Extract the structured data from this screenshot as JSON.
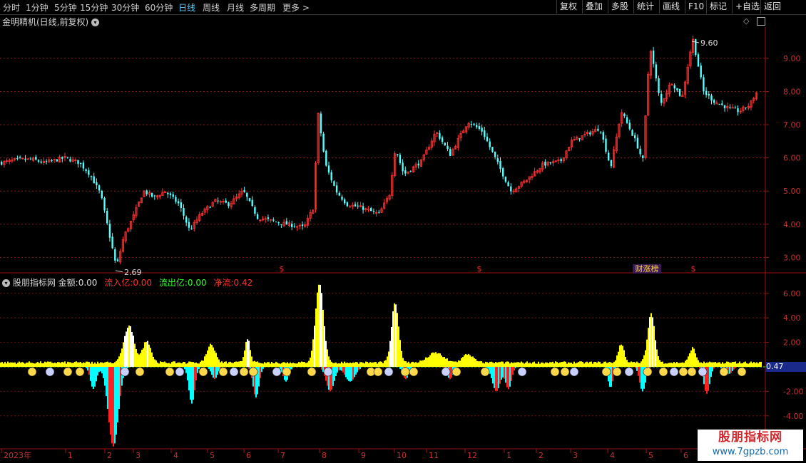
{
  "toolbar": {
    "timeframes": [
      "分时",
      "1分钟",
      "5分钟",
      "15分钟",
      "30分钟",
      "60分钟",
      "日线",
      "周线",
      "月线",
      "多周期",
      "更多 >"
    ],
    "active_timeframe": "日线",
    "actions": [
      "复权",
      "叠加",
      "多股",
      "统计",
      "画线",
      "F10",
      "标记",
      "+自选",
      "返回"
    ]
  },
  "main_chart": {
    "title": "金明精机(日线,前复权)",
    "high_label": "9.60",
    "low_label": "2.69",
    "y_ticks": [
      "9.00",
      "8.00",
      "7.00",
      "6.00",
      "5.00",
      "4.00",
      "3.00"
    ],
    "event_marker": "财涨榜",
    "dividend_marker": "$",
    "colors": {
      "up": "#ff3232",
      "down": "#54ffff",
      "grid": "#8a1a1a",
      "axis": "#a01010"
    }
  },
  "indicator": {
    "name": "股朋指标网",
    "fields": [
      {
        "label": "金额:",
        "value": "0.00",
        "color": "#dddddd"
      },
      {
        "label": "流入亿:",
        "value": "0.00",
        "color": "#ff3232"
      },
      {
        "label": "流出亿:",
        "value": "0.00",
        "color": "#33ff33"
      },
      {
        "label": "净流:",
        "value": "0.42",
        "color": "#ff3232"
      }
    ],
    "y_ticks": [
      "6.00",
      "4.00",
      "2.00",
      "-2.00",
      "-4.00"
    ],
    "current_value": "0.47",
    "colors": {
      "pos": "#ffff00",
      "pos_hi": "#ffffff",
      "neg": "#00ffff",
      "neg_red": "#ff2020",
      "faces": "#ffd84a"
    }
  },
  "time_axis": {
    "labels": [
      "2023年",
      "1",
      "2",
      "3",
      "4",
      "5",
      "6",
      "7",
      "8",
      "9",
      "10",
      "11",
      "12",
      "1",
      "2",
      "3",
      "4",
      "5",
      "6"
    ]
  },
  "watermark": {
    "title": "股朋指标网",
    "url": "www.7gpzb.com"
  },
  "chart_data": {
    "type": "candlestick",
    "title": "金明精机(日线,前复权)",
    "ylim": [
      2.6,
      9.9
    ],
    "price_path": [
      [
        0,
        5.85
      ],
      [
        25,
        5.95
      ],
      [
        45,
        5.95
      ],
      [
        60,
        5.85
      ],
      [
        90,
        6.0
      ],
      [
        110,
        5.85
      ],
      [
        125,
        5.5
      ],
      [
        140,
        4.9
      ],
      [
        150,
        3.9
      ],
      [
        158,
        3.1
      ],
      [
        162,
        2.69
      ],
      [
        172,
        3.6
      ],
      [
        185,
        4.2
      ],
      [
        200,
        5.0
      ],
      [
        215,
        4.8
      ],
      [
        230,
        5.0
      ],
      [
        250,
        4.6
      ],
      [
        265,
        3.8
      ],
      [
        280,
        4.3
      ],
      [
        300,
        4.7
      ],
      [
        320,
        4.6
      ],
      [
        340,
        5.0
      ],
      [
        360,
        4.2
      ],
      [
        380,
        4.1
      ],
      [
        400,
        4.0
      ],
      [
        425,
        3.9
      ],
      [
        438,
        4.5
      ],
      [
        445,
        7.3
      ],
      [
        455,
        5.8
      ],
      [
        470,
        5.0
      ],
      [
        485,
        4.6
      ],
      [
        505,
        4.5
      ],
      [
        530,
        4.3
      ],
      [
        545,
        4.9
      ],
      [
        553,
        6.3
      ],
      [
        565,
        5.5
      ],
      [
        590,
        5.9
      ],
      [
        610,
        6.8
      ],
      [
        630,
        6.1
      ],
      [
        655,
        7.1
      ],
      [
        675,
        6.8
      ],
      [
        695,
        5.9
      ],
      [
        715,
        5.0
      ],
      [
        735,
        5.3
      ],
      [
        760,
        5.8
      ],
      [
        785,
        5.9
      ],
      [
        800,
        6.5
      ],
      [
        820,
        6.7
      ],
      [
        840,
        6.9
      ],
      [
        855,
        5.7
      ],
      [
        870,
        7.4
      ],
      [
        890,
        6.5
      ],
      [
        900,
        5.9
      ],
      [
        910,
        9.4
      ],
      [
        925,
        7.6
      ],
      [
        940,
        8.3
      ],
      [
        955,
        7.8
      ],
      [
        970,
        9.6
      ],
      [
        985,
        8.0
      ],
      [
        1000,
        7.7
      ],
      [
        1020,
        7.5
      ],
      [
        1035,
        7.4
      ],
      [
        1050,
        7.6
      ],
      [
        1060,
        8.0
      ]
    ],
    "low_point": {
      "x": 162,
      "y": 2.69
    },
    "high_point": {
      "x": 970,
      "y": 9.6
    }
  }
}
